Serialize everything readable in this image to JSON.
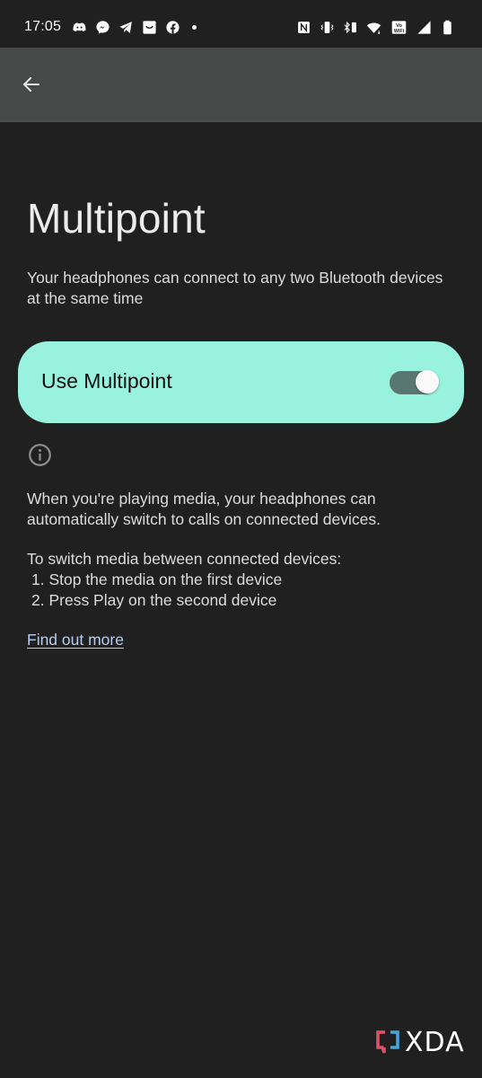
{
  "status_bar": {
    "time": "17:05",
    "left_icons": [
      "discord-icon",
      "messenger-icon",
      "telegram-icon",
      "shopping-bag-icon",
      "facebook-icon",
      "more-notifications-dot"
    ],
    "right_icons": [
      "nfc-icon",
      "vibrate-icon",
      "bluetooth-battery-icon",
      "wifi-icon",
      "vowifi-icon",
      "signal-icon",
      "battery-icon"
    ],
    "vowifi_label": "Vo WiFi"
  },
  "app_bar": {
    "back_icon": "arrow-left-icon"
  },
  "main": {
    "title": "Multipoint",
    "subtitle": "Your headphones can connect to any two Bluetooth devices at the same time",
    "toggle": {
      "label": "Use Multipoint",
      "state": "on",
      "card_color": "#98f2dd"
    },
    "info": {
      "icon": "info-icon",
      "paragraph1": "When you're playing media, your headphones can automatically switch to calls on connected devices.",
      "paragraph2_intro": "To switch media between connected devices:",
      "steps": [
        "1. Stop the media on the first device",
        "2. Press Play on the second device"
      ],
      "link": "Find out more"
    }
  },
  "watermark": {
    "text": "XDA"
  }
}
